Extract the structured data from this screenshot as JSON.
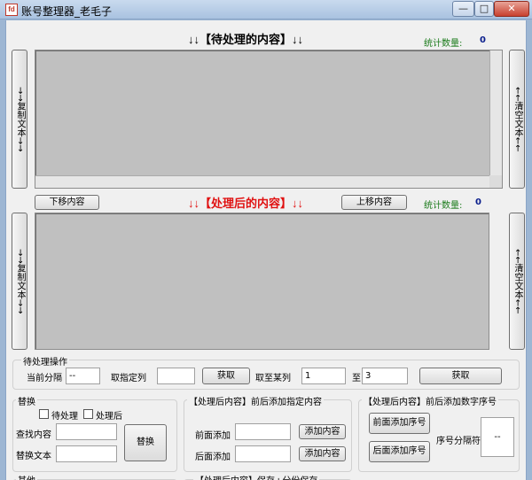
{
  "window": {
    "title": "账号整理器_老毛子",
    "app_icon_text": "fd",
    "minimize": "—",
    "maximize": "□",
    "close": "✕"
  },
  "top": {
    "heading": "↓↓【待处理的内容】↓↓",
    "stat_label": "统计数量:",
    "stat_value": "0",
    "left_button": "→→复制文本→→",
    "right_button": "←←清空文本←←"
  },
  "bottom": {
    "move_down": "下移内容",
    "heading": "↓↓【处理后的内容】↓↓",
    "move_up": "上移内容",
    "stat_label": "统计数量:",
    "stat_value": "0",
    "left_button": "→→复制文本→→",
    "right_button": "←←清空文本←←"
  },
  "pending_ops": {
    "title": "待处理操作",
    "current_sep_label": "当前分隔",
    "current_sep_value": "--",
    "fetch_col_label": "取指定列",
    "fetch_col_value": "",
    "fetch_button": "获取",
    "range_label": "取至某列",
    "range_from": "1",
    "range_to_label": "至",
    "range_to": "3",
    "range_button": "获取"
  },
  "replace": {
    "title": "替换",
    "cb_pending": "待处理",
    "cb_processed": "处理后",
    "find_label": "查找内容",
    "find_value": "",
    "replace_label": "替换文本",
    "replace_value": "",
    "button": "替换"
  },
  "add_content": {
    "title": "【处理后内容】前后添加指定内容",
    "front_label": "前面添加",
    "front_value": "",
    "front_button": "添加内容",
    "back_label": "后面添加",
    "back_value": "",
    "back_button": "添加内容"
  },
  "add_seq": {
    "title": "【处理后内容】前后添加数字序号",
    "front_button": "前面添加序号",
    "back_button": "后面添加序号",
    "sep_label": "序号分隔符",
    "sep_value": "--"
  },
  "bottom_groups": {
    "other_title": "其他",
    "save_title": "【处理后内容】保存+分份保存"
  },
  "colors": {
    "heading_top": "#000000",
    "heading_bottom": "#e01010",
    "stat_label": "#1a7a1a",
    "stat_value": "#0a1e8c",
    "textarea_bg": "#c0c0c0"
  }
}
